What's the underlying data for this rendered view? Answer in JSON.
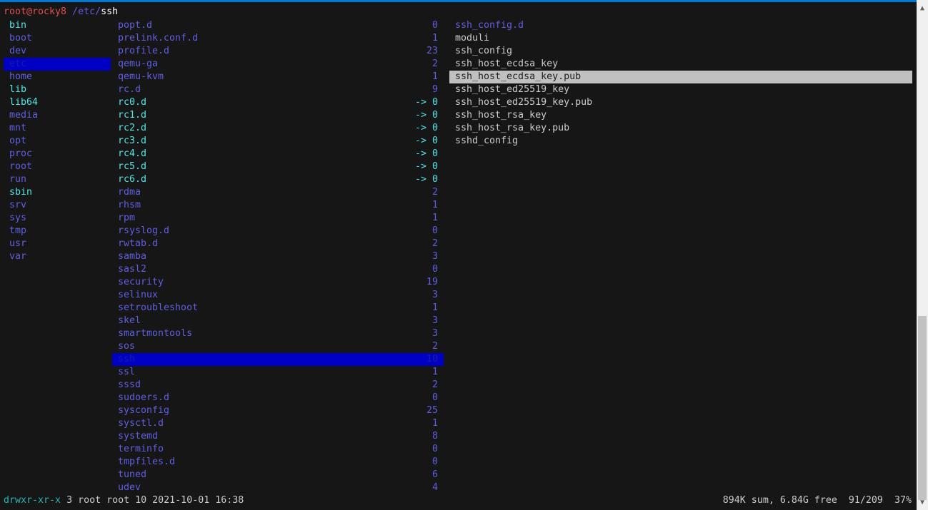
{
  "header": {
    "user_host": "root@rocky8",
    "path_prefix": "/etc/",
    "current": "ssh"
  },
  "colors": {
    "dir": "#5f5fe0",
    "link": "#55e6e6",
    "file": "#cccccc",
    "selection": "#0000c4",
    "preview_selection": "#c0c0c0",
    "user_host": "#e05050",
    "accent_bar": "#0078d4"
  },
  "parent_column": [
    {
      "name": "bin",
      "type": "link"
    },
    {
      "name": "boot",
      "type": "dir"
    },
    {
      "name": "dev",
      "type": "dir"
    },
    {
      "name": "etc",
      "type": "dir",
      "selected": true
    },
    {
      "name": "home",
      "type": "dir"
    },
    {
      "name": "lib",
      "type": "link"
    },
    {
      "name": "lib64",
      "type": "link"
    },
    {
      "name": "media",
      "type": "dir"
    },
    {
      "name": "mnt",
      "type": "dir"
    },
    {
      "name": "opt",
      "type": "dir"
    },
    {
      "name": "proc",
      "type": "dir"
    },
    {
      "name": "root",
      "type": "dir"
    },
    {
      "name": "run",
      "type": "dir"
    },
    {
      "name": "sbin",
      "type": "link"
    },
    {
      "name": "srv",
      "type": "dir"
    },
    {
      "name": "sys",
      "type": "dir"
    },
    {
      "name": "tmp",
      "type": "dir"
    },
    {
      "name": "usr",
      "type": "dir"
    },
    {
      "name": "var",
      "type": "dir"
    }
  ],
  "current_column": [
    {
      "name": "popt.d",
      "size": "0",
      "type": "dir"
    },
    {
      "name": "prelink.conf.d",
      "size": "1",
      "type": "dir"
    },
    {
      "name": "profile.d",
      "size": "23",
      "type": "dir"
    },
    {
      "name": "qemu-ga",
      "size": "2",
      "type": "dir"
    },
    {
      "name": "qemu-kvm",
      "size": "1",
      "type": "dir"
    },
    {
      "name": "rc.d",
      "size": "9",
      "type": "dir"
    },
    {
      "name": "rc0.d",
      "size": "-> 0",
      "type": "link"
    },
    {
      "name": "rc1.d",
      "size": "-> 0",
      "type": "link"
    },
    {
      "name": "rc2.d",
      "size": "-> 0",
      "type": "link"
    },
    {
      "name": "rc3.d",
      "size": "-> 0",
      "type": "link"
    },
    {
      "name": "rc4.d",
      "size": "-> 0",
      "type": "link"
    },
    {
      "name": "rc5.d",
      "size": "-> 0",
      "type": "link"
    },
    {
      "name": "rc6.d",
      "size": "-> 0",
      "type": "link"
    },
    {
      "name": "rdma",
      "size": "2",
      "type": "dir"
    },
    {
      "name": "rhsm",
      "size": "1",
      "type": "dir"
    },
    {
      "name": "rpm",
      "size": "1",
      "type": "dir"
    },
    {
      "name": "rsyslog.d",
      "size": "0",
      "type": "dir"
    },
    {
      "name": "rwtab.d",
      "size": "2",
      "type": "dir"
    },
    {
      "name": "samba",
      "size": "3",
      "type": "dir"
    },
    {
      "name": "sasl2",
      "size": "0",
      "type": "dir"
    },
    {
      "name": "security",
      "size": "19",
      "type": "dir"
    },
    {
      "name": "selinux",
      "size": "3",
      "type": "dir"
    },
    {
      "name": "setroubleshoot",
      "size": "1",
      "type": "dir"
    },
    {
      "name": "skel",
      "size": "3",
      "type": "dir"
    },
    {
      "name": "smartmontools",
      "size": "3",
      "type": "dir"
    },
    {
      "name": "sos",
      "size": "2",
      "type": "dir"
    },
    {
      "name": "ssh",
      "size": "10",
      "type": "dir",
      "selected": true
    },
    {
      "name": "ssl",
      "size": "1",
      "type": "dir"
    },
    {
      "name": "sssd",
      "size": "2",
      "type": "dir"
    },
    {
      "name": "sudoers.d",
      "size": "0",
      "type": "dir"
    },
    {
      "name": "sysconfig",
      "size": "25",
      "type": "dir"
    },
    {
      "name": "sysctl.d",
      "size": "1",
      "type": "dir"
    },
    {
      "name": "systemd",
      "size": "8",
      "type": "dir"
    },
    {
      "name": "terminfo",
      "size": "0",
      "type": "dir"
    },
    {
      "name": "tmpfiles.d",
      "size": "0",
      "type": "dir"
    },
    {
      "name": "tuned",
      "size": "6",
      "type": "dir"
    },
    {
      "name": "udev",
      "size": "4",
      "type": "dir"
    }
  ],
  "preview_column": [
    {
      "name": "ssh_config.d",
      "type": "dir"
    },
    {
      "name": "moduli",
      "type": "file"
    },
    {
      "name": "ssh_config",
      "type": "file"
    },
    {
      "name": "ssh_host_ecdsa_key",
      "type": "file"
    },
    {
      "name": "ssh_host_ecdsa_key.pub",
      "type": "file",
      "selected": true
    },
    {
      "name": "ssh_host_ed25519_key",
      "type": "file"
    },
    {
      "name": "ssh_host_ed25519_key.pub",
      "type": "file"
    },
    {
      "name": "ssh_host_rsa_key",
      "type": "file"
    },
    {
      "name": "ssh_host_rsa_key.pub",
      "type": "file"
    },
    {
      "name": "sshd_config",
      "type": "file"
    }
  ],
  "status": {
    "permissions": "drwxr-xr-x",
    "info": "3 root root 10 2021-10-01 16:38",
    "summary": "894K sum, 6.84G free",
    "position": "91/209",
    "percent": "37%"
  },
  "scrollbar": {
    "thumb_start_fraction": 0.62,
    "thumb_end_fraction": 0.98
  }
}
